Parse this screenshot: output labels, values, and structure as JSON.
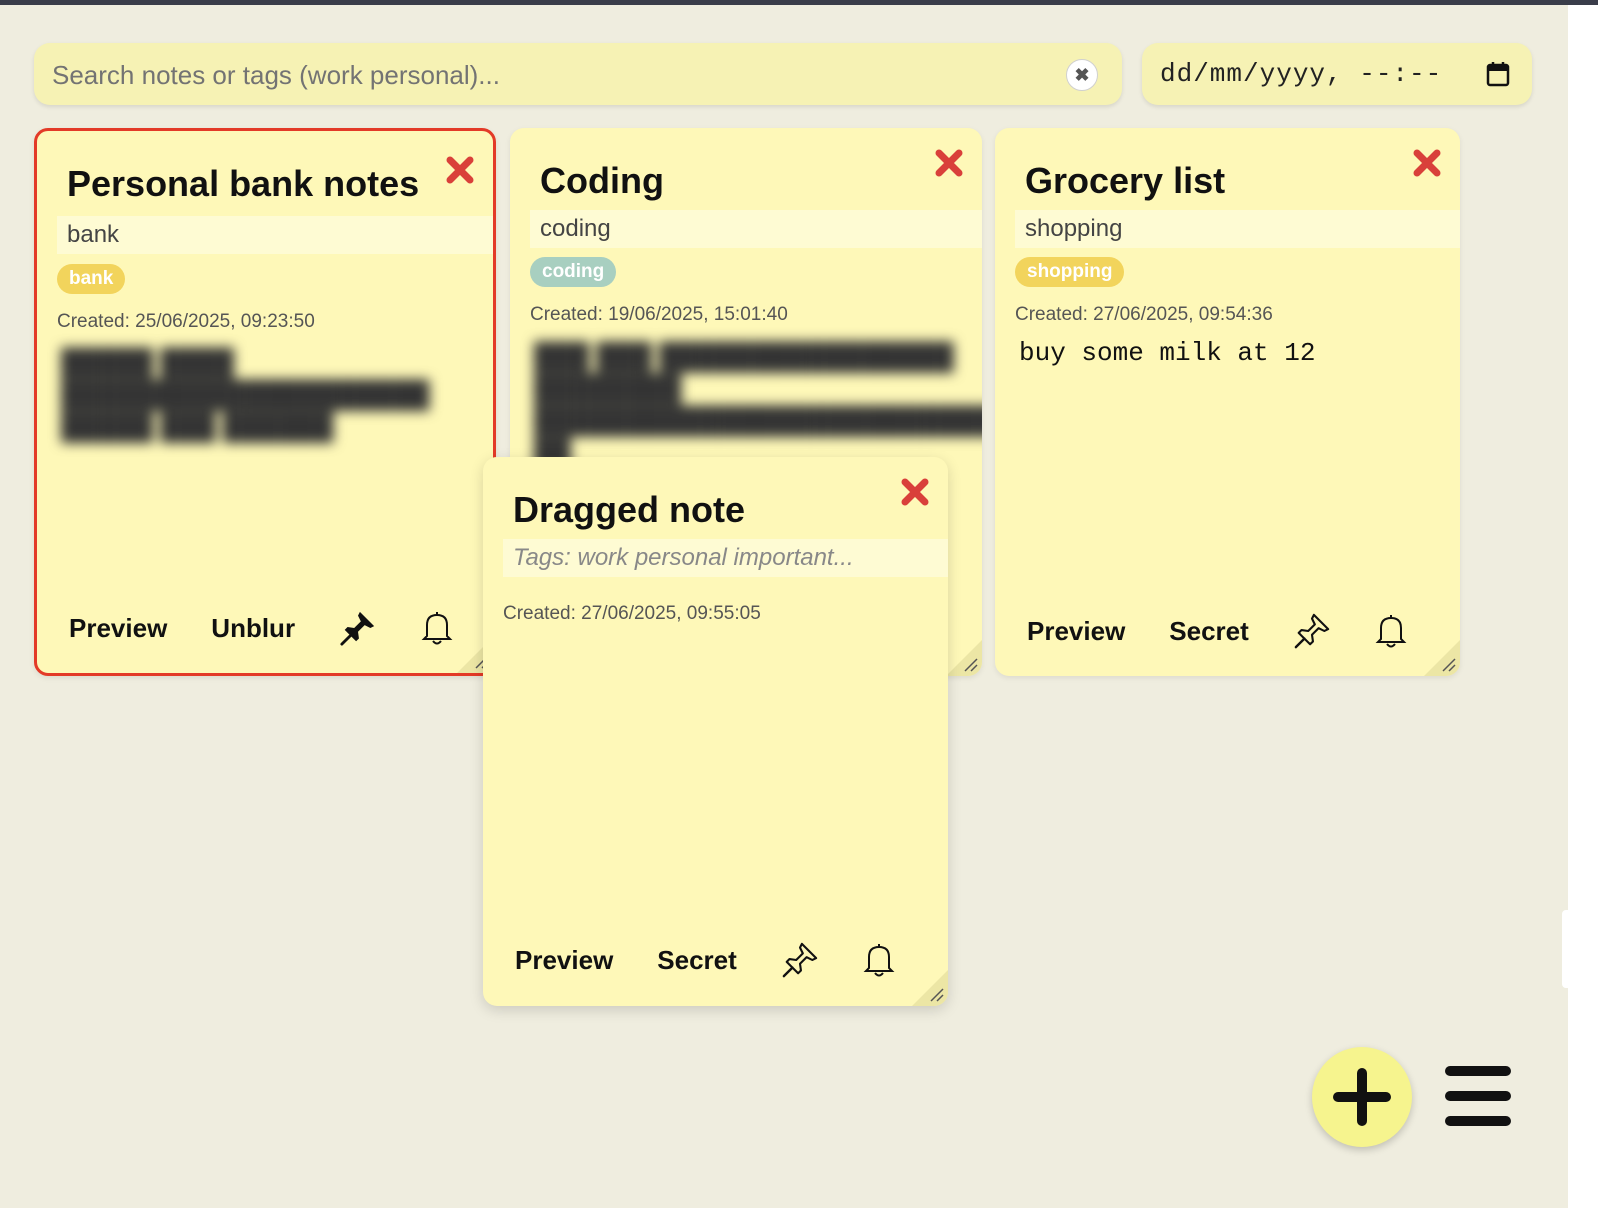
{
  "search": {
    "placeholder": "Search notes or tags (work personal)...",
    "clear_symbol": "✖"
  },
  "datetime_filter": {
    "placeholder": "dd/mm/yyyy, --:--"
  },
  "notes": [
    {
      "title": "Personal bank notes",
      "tags_value": "bank",
      "tag_chips": [
        {
          "label": "bank",
          "color": "#f2d45c"
        }
      ],
      "created": "Created: 25/06/2025, 09:23:50",
      "blurred": true,
      "pinned": true,
      "selected": true,
      "actions": {
        "preview": "Preview",
        "secret": "Unblur"
      }
    },
    {
      "title": "Coding",
      "tags_value": "coding",
      "tag_chips": [
        {
          "label": "coding",
          "color": "#a8cfc0"
        }
      ],
      "created": "Created: 19/06/2025, 15:01:40",
      "blurred": true,
      "pinned": false,
      "actions": {
        "preview": "Preview",
        "secret": "Secret"
      }
    },
    {
      "title": "Grocery list",
      "tags_value": "shopping",
      "tag_chips": [
        {
          "label": "shopping",
          "color": "#f2d45c"
        }
      ],
      "created": "Created: 27/06/2025, 09:54:36",
      "body": "buy some milk at 12",
      "blurred": false,
      "pinned": false,
      "actions": {
        "preview": "Preview",
        "secret": "Secret"
      }
    },
    {
      "title": "Dragged note",
      "tags_placeholder": "Tags: work personal important...",
      "created": "Created: 27/06/2025, 09:55:05",
      "blurred": false,
      "pinned": false,
      "dragged": true,
      "actions": {
        "preview": "Preview",
        "secret": "Secret"
      }
    }
  ],
  "colors": {
    "background": "#efeddf",
    "note": "#fef8b8",
    "input": "#f6f2b4",
    "selected_border": "#e33a27",
    "close_icon": "#d9403a",
    "fab": "#f6f48e"
  },
  "icons": {
    "close": "close-x-icon",
    "pin_filled": "pushpin-filled-icon",
    "pin_outline": "pushpin-outline-icon",
    "bell": "bell-icon",
    "calendar": "calendar-icon",
    "add": "plus-icon",
    "menu": "hamburger-menu-icon"
  }
}
